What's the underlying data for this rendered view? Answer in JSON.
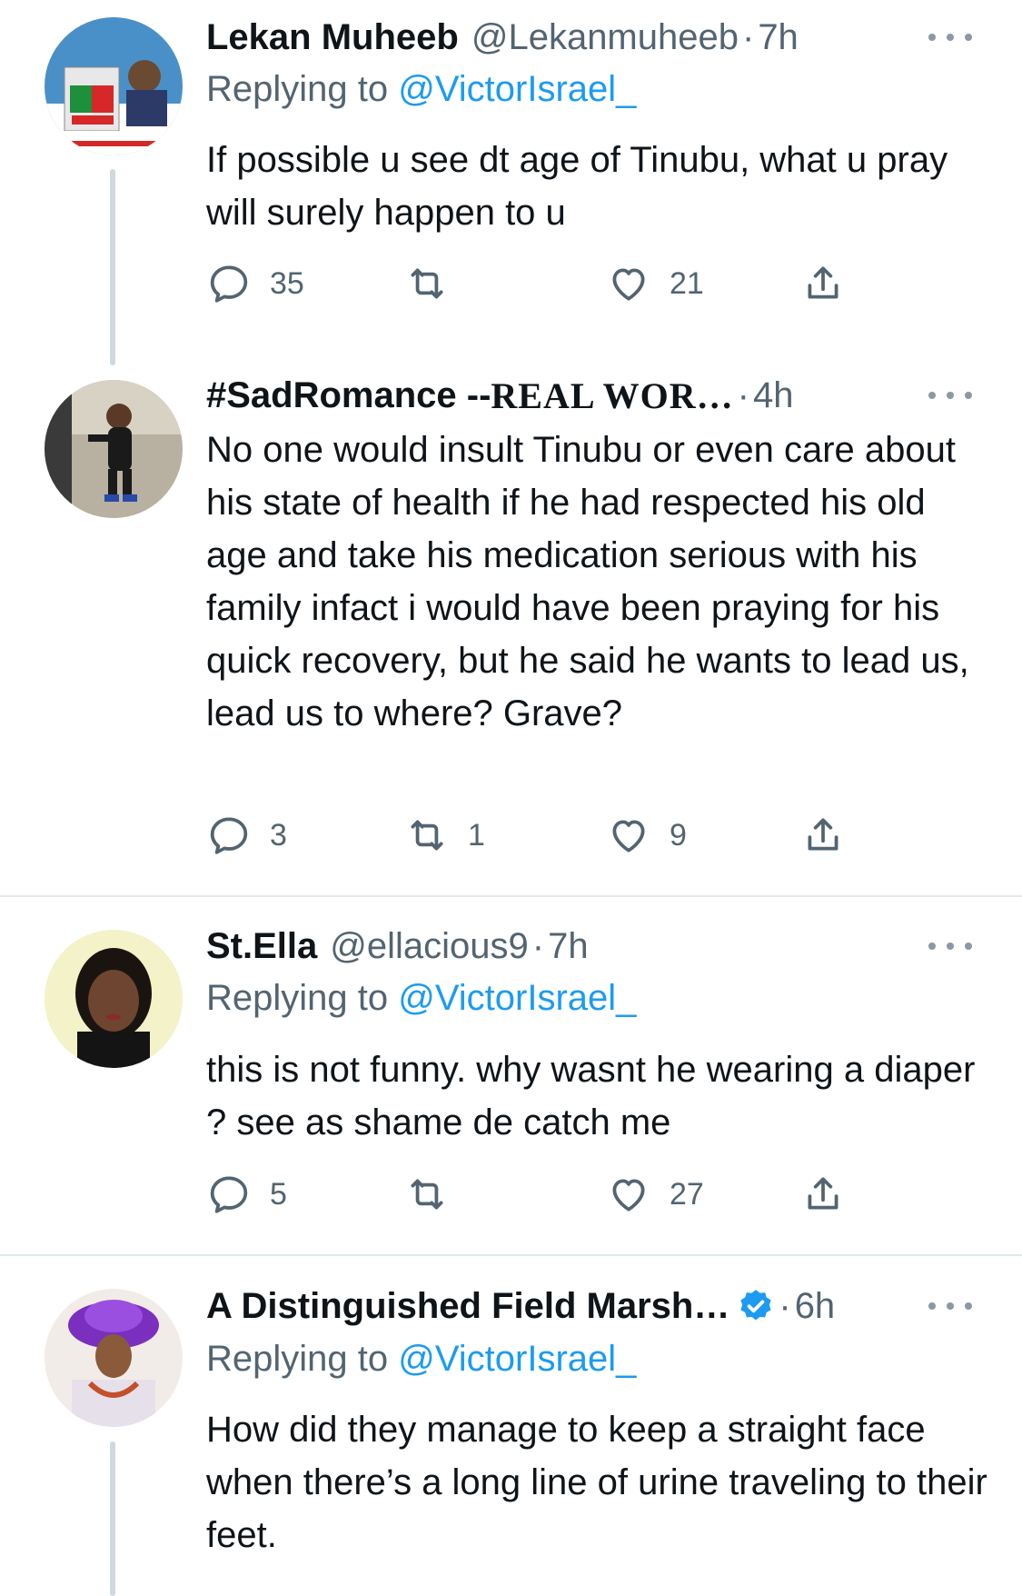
{
  "tweets": [
    {
      "name": "Lekan Muheeb",
      "handle": "@Lekanmuheeb",
      "time": "7h",
      "replying_prefix": "Replying to ",
      "replying_to": "@VictorIsrael_",
      "text": "If possible u see dt age of Tinubu, what u pray will surely happen to u",
      "replies": "35",
      "retweets": "",
      "likes": "21",
      "avatar_icon": "apc-campaign-avatar"
    },
    {
      "name": "#SadRomance -- ",
      "name_serif": "REAL WOR…",
      "handle": "",
      "time": "4h",
      "text": "No one would insult Tinubu or even care about his state of health if he had respected his old age and take his medication serious with his family infact i would have been praying for his quick recovery, but he said he wants to lead us, lead us to where?  Grave?",
      "replies": "3",
      "retweets": "1",
      "likes": "9",
      "avatar_icon": "child-photo-avatar"
    },
    {
      "name": "St.Ella",
      "handle": "@ellacious9",
      "time": "7h",
      "replying_prefix": "Replying to ",
      "replying_to": "@VictorIsrael_",
      "text": "this is not funny. why wasnt he wearing a diaper ? see as shame de catch me",
      "replies": "5",
      "retweets": "",
      "likes": "27",
      "avatar_icon": "woman-photo-avatar"
    },
    {
      "name": "A Distinguished Field Marsh…",
      "handle": "",
      "time": "6h",
      "verified": true,
      "replying_prefix": "Replying to ",
      "replying_to": "@VictorIsrael_",
      "text": "How did they manage to keep a straight face when there’s a long line of urine traveling to their feet.",
      "avatar_icon": "woman-gele-avatar"
    }
  ],
  "separator": "·",
  "colors": {
    "text": "#0f1419",
    "secondary": "#536471",
    "link": "#1d9bf0",
    "divider": "#e1e8ed",
    "thread_line": "#cfd9de"
  }
}
